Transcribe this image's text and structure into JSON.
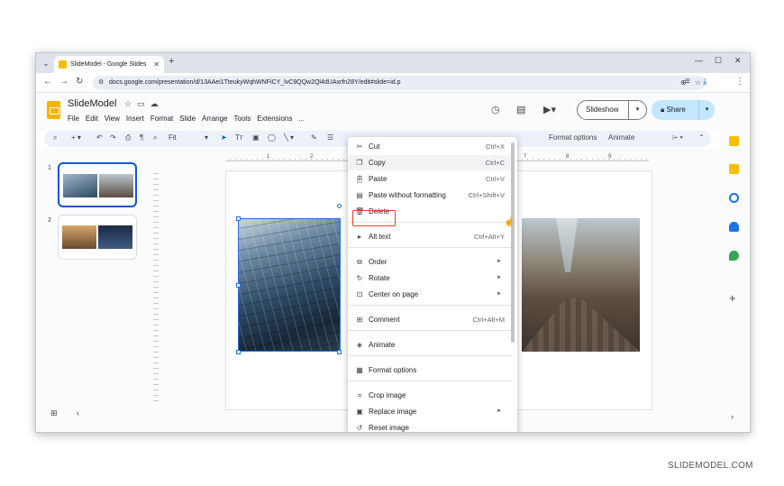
{
  "browser": {
    "tab_title": "SlideModel - Google Slides",
    "url": "docs.google.com/presentation/d/13AAei1TteukyWqhWNFiCY_lvC9QQw2Ql4dUAxrfn28Y/edit#slide=id.p"
  },
  "app": {
    "title": "SlideModel",
    "menu": [
      "File",
      "Edit",
      "View",
      "Insert",
      "Format",
      "Slide",
      "Arrange",
      "Tools",
      "Extensions",
      "..."
    ],
    "slideshow_label": "Slideshow",
    "share_label": "Share",
    "zoom_label": "Fit",
    "toolbar_format_options": "Format options",
    "toolbar_animate": "Animate"
  },
  "filmstrip": {
    "slides": [
      {
        "number": "1"
      },
      {
        "number": "2"
      }
    ]
  },
  "ruler": [
    "1",
    "2",
    "3",
    "4",
    "5",
    "6",
    "7",
    "8",
    "9"
  ],
  "context_menu": {
    "items": [
      {
        "icon": "cut-icon",
        "label": "Cut",
        "shortcut": "Ctrl+X"
      },
      {
        "icon": "copy-icon",
        "label": "Copy",
        "shortcut": "Ctrl+C"
      },
      {
        "icon": "paste-icon",
        "label": "Paste",
        "shortcut": "Ctrl+V"
      },
      {
        "icon": "paste-plain-icon",
        "label": "Paste without formatting",
        "shortcut": "Ctrl+Shift+V"
      },
      {
        "icon": "delete-icon",
        "label": "Delete",
        "shortcut": ""
      },
      {
        "icon": "alt-text-icon",
        "label": "Alt text",
        "shortcut": "Ctrl+Alt+Y"
      },
      {
        "icon": "order-icon",
        "label": "Order",
        "shortcut": ""
      },
      {
        "icon": "rotate-icon",
        "label": "Rotate",
        "shortcut": ""
      },
      {
        "icon": "center-icon",
        "label": "Center on page",
        "shortcut": ""
      },
      {
        "icon": "comment-icon",
        "label": "Comment",
        "shortcut": "Ctrl+Alt+M"
      },
      {
        "icon": "animate-icon",
        "label": "Animate",
        "shortcut": ""
      },
      {
        "icon": "format-options-icon",
        "label": "Format options",
        "shortcut": ""
      },
      {
        "icon": "crop-icon",
        "label": "Crop image",
        "shortcut": ""
      },
      {
        "icon": "replace-image-icon",
        "label": "Replace image",
        "shortcut": ""
      },
      {
        "icon": "reset-image-icon",
        "label": "Reset image",
        "shortcut": ""
      }
    ]
  },
  "watermark": "SLIDEMODEL.COM"
}
